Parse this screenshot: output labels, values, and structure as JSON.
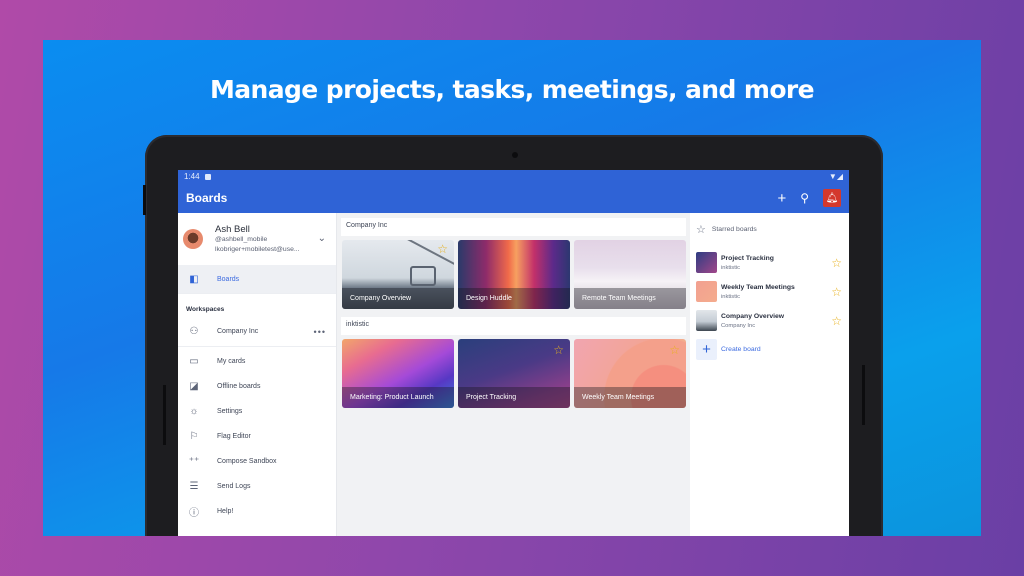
{
  "headline": "Manage projects, tasks, meetings, and more",
  "status_bar": {
    "time": "1:44"
  },
  "app_bar": {
    "title": "Boards",
    "icons": {
      "add": "plus-icon",
      "search": "search-icon",
      "notifications": "bell-icon"
    },
    "notification_color": "#d4382c"
  },
  "account": {
    "name": "Ash Bell",
    "username": "@ashbell_mobile",
    "email": "lkobriger+mobiletest@use..."
  },
  "drawer": {
    "boards_label": "Boards",
    "workspaces_label": "Workspaces",
    "workspace_name": "Company Inc",
    "items": [
      {
        "label": "My cards",
        "icon": "card-icon"
      },
      {
        "label": "Offline boards",
        "icon": "offline-board-icon"
      },
      {
        "label": "Settings",
        "icon": "gear-icon"
      },
      {
        "label": "Flag Editor",
        "icon": "flag-icon"
      },
      {
        "label": "Compose Sandbox",
        "icon": "sparkle-icon"
      },
      {
        "label": "Send Logs",
        "icon": "logs-icon"
      },
      {
        "label": "Help!",
        "icon": "help-icon"
      }
    ]
  },
  "workspaces": [
    {
      "name": "Company Inc",
      "boards": [
        {
          "title": "Company Overview",
          "starred": true
        },
        {
          "title": "Design Huddle",
          "starred": false
        },
        {
          "title": "Remote Team Meetings",
          "starred": false
        }
      ]
    },
    {
      "name": "inktistic",
      "boards": [
        {
          "title": "Marketing: Product Launch",
          "starred": false
        },
        {
          "title": "Project Tracking",
          "starred": true
        },
        {
          "title": "Weekly Team Meetings",
          "starred": true
        }
      ]
    }
  ],
  "starred": {
    "heading": "Starred boards",
    "items": [
      {
        "title": "Project Tracking",
        "workspace": "inktistic"
      },
      {
        "title": "Weekly Team Meetings",
        "workspace": "inktistic"
      },
      {
        "title": "Company Overview",
        "workspace": "Company Inc"
      }
    ],
    "create_label": "Create board"
  },
  "accent_color": "#2f63d6",
  "star_color": "#e7b11d"
}
